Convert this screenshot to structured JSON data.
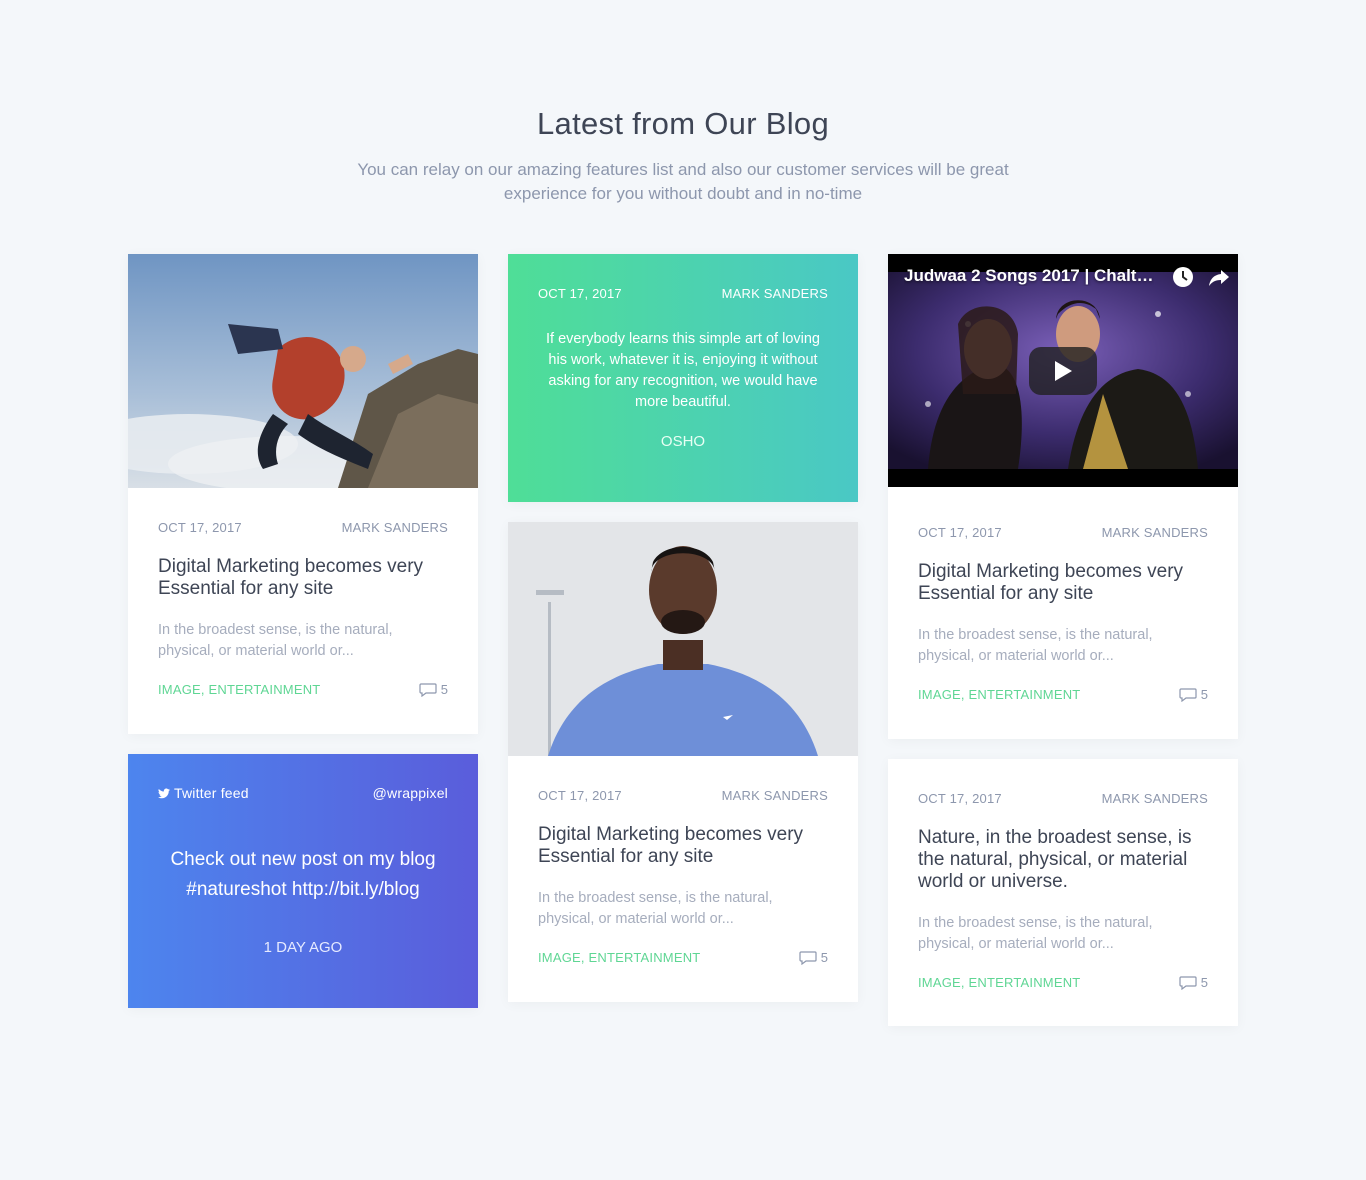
{
  "section": {
    "title": "Latest from Our Blog",
    "subtitle": "You can relay on our amazing features list and also our customer services will be great experience for you without doubt and in no-time"
  },
  "posts": [
    {
      "date": "OCT 17, 2017",
      "author": "MARK SANDERS",
      "title": "Digital Marketing becomes very Essential for any site",
      "excerpt": "In the broadest sense, is the natural, physical, or material world or...",
      "tags": "IMAGE, ENTERTAINMENT",
      "comments": "5",
      "image": "photo-man-jumping-scarf"
    },
    {
      "date": "OCT 17, 2017",
      "author": "MARK SANDERS",
      "title": "Digital Marketing becomes very Essential for any site",
      "excerpt": "In the broadest sense, is the natural, physical, or material world or...",
      "tags": "IMAGE, ENTERTAINMENT",
      "comments": "5",
      "image": "photo-man-blue-tshirt"
    },
    {
      "date": "OCT 17, 2017",
      "author": "MARK SANDERS",
      "title": "Digital Marketing becomes very Essential for any site",
      "excerpt": "In the broadest sense, is the natural, physical, or material world or...",
      "tags": "IMAGE, ENTERTAINMENT",
      "comments": "5",
      "video_title": "Judwaa 2 Songs 2017 | Chalti..."
    },
    {
      "date": "OCT 17, 2017",
      "author": "MARK SANDERS",
      "title": "Nature, in the broadest sense, is the natural, physical, or material world or universe.",
      "excerpt": "In the broadest sense, is the natural, physical, or material world or...",
      "tags": "IMAGE, ENTERTAINMENT",
      "comments": "5"
    }
  ],
  "quote": {
    "date": "OCT 17, 2017",
    "author": "MARK SANDERS",
    "text": "If everybody learns this simple art of loving his work, whatever it is, enjoying it without asking for any recognition, we would have more beautiful.",
    "by": "OSHO"
  },
  "twitter": {
    "label": "Twitter feed",
    "handle": "@wrappixel",
    "text": "Check out new post on my blog #natureshot http://bit.ly/blog",
    "time": "1 DAY AGO"
  },
  "colors": {
    "accent_green": "#5fd694",
    "quote_gradient": [
      "#4fde97",
      "#4ac8c5"
    ],
    "twitter_gradient": [
      "#4d85ee",
      "#5a5ddb"
    ],
    "background": "#f4f7fa"
  }
}
